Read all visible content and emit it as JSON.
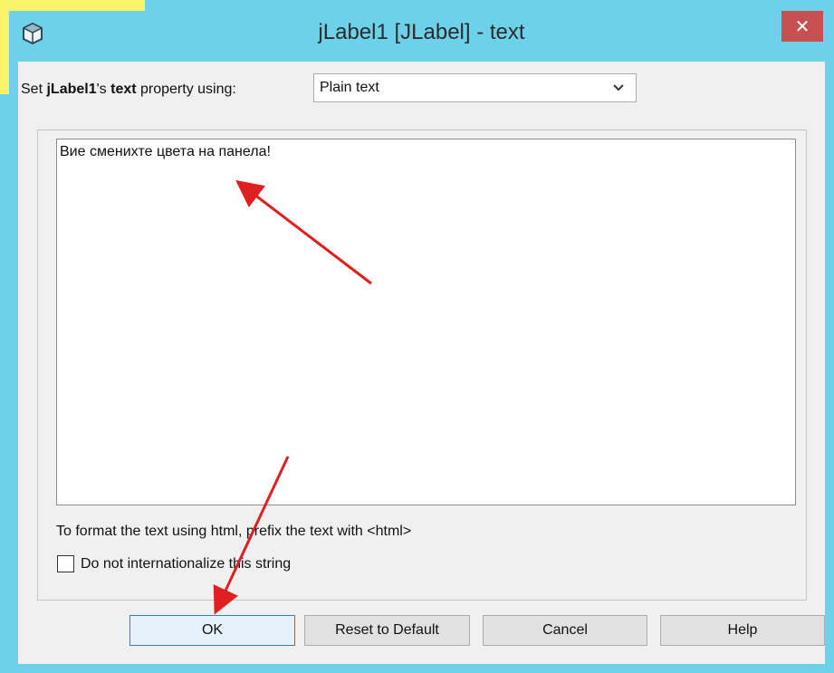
{
  "dialog": {
    "title": "jLabel1 [JLabel] - text",
    "close_glyph": "✕",
    "app_icon": "cube-icon"
  },
  "property_row": {
    "prefix": "Set ",
    "component": "jLabel1",
    "possessive": "'s ",
    "property": "text",
    "suffix": " property using:",
    "editor_mode": "Plain text"
  },
  "editor": {
    "text_value": "Вие сменихте цвета на панела!"
  },
  "hint": "To format the text using html, prefix the text with <html>",
  "option": {
    "label": "Do not internationalize this string",
    "checked": false
  },
  "buttons": {
    "ok": "OK",
    "reset": "Reset to Default",
    "cancel": "Cancel",
    "help": "Help"
  },
  "annotations": {
    "arrow_color": "#e02020"
  },
  "colors": {
    "titlebar": "#6ed1ea",
    "close_button": "#c75050",
    "dialog_bg": "#f0f0f0"
  }
}
